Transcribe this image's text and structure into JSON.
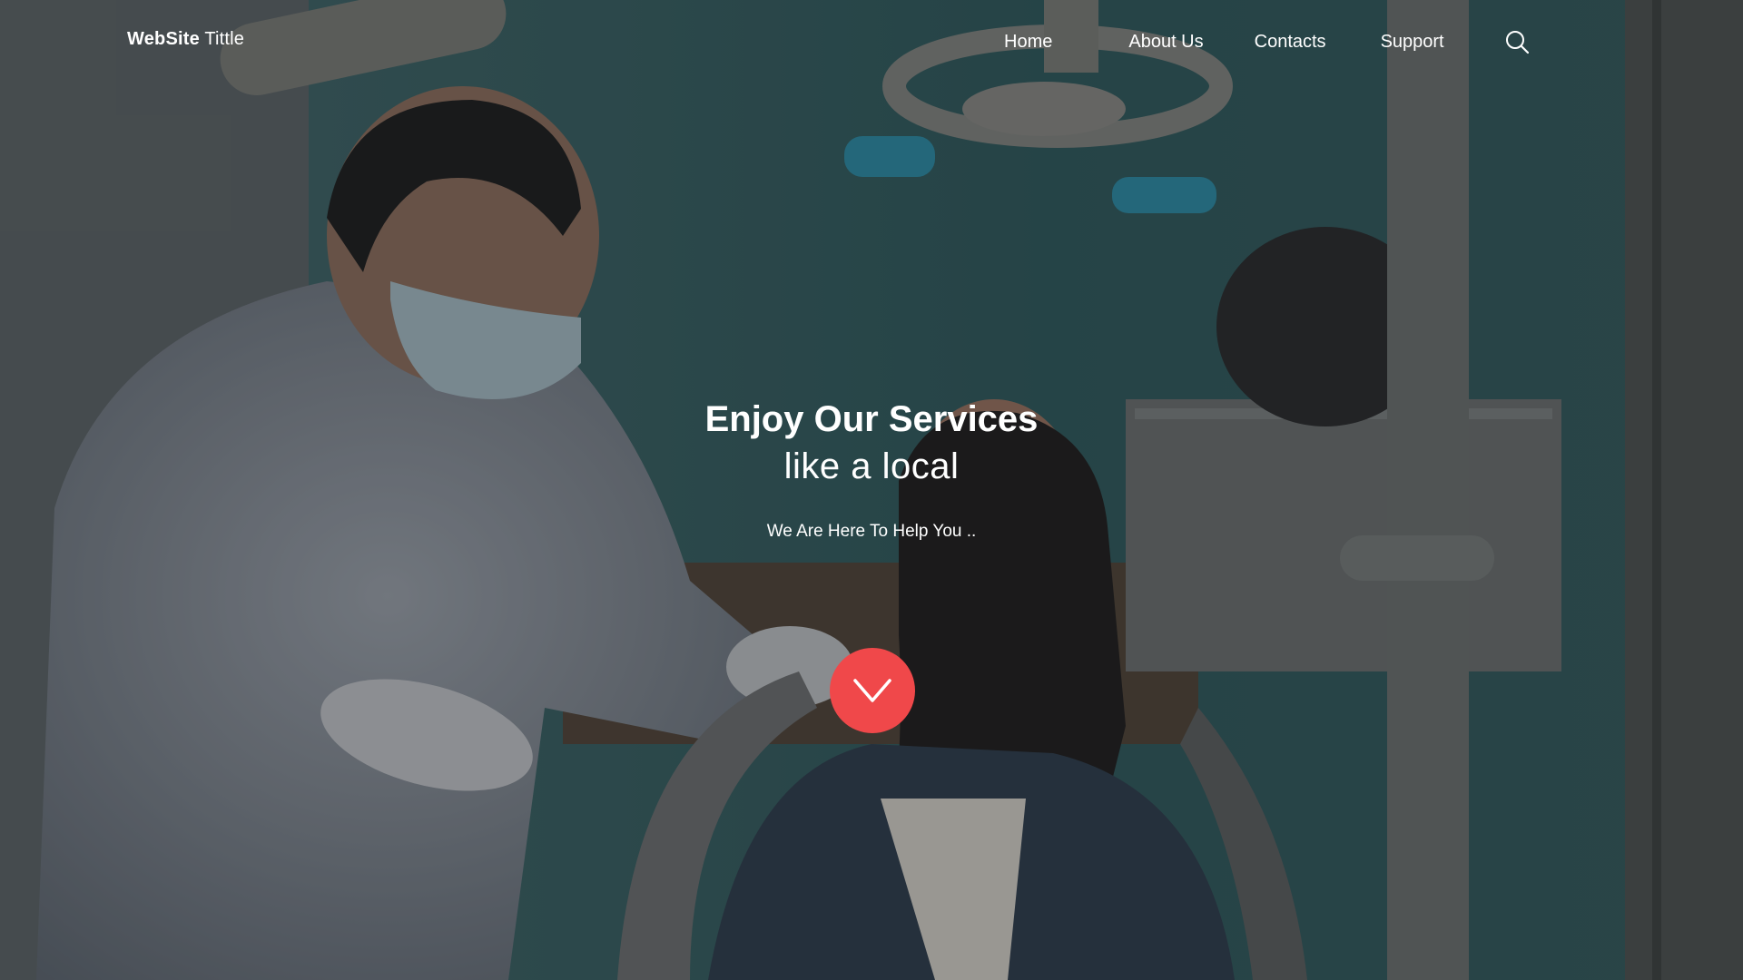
{
  "header": {
    "brand_strong": "WebSite",
    "brand_light": " Tittle",
    "nav": {
      "home": "Home",
      "about": "About Us",
      "contacts": "Contacts",
      "support": "Support"
    },
    "search_icon": "search-icon"
  },
  "hero": {
    "title": "Enjoy Our Services",
    "subtitle": "like a local",
    "tagline": "We Are Here To Help You ..",
    "scroll_icon": "chevron-down-icon",
    "background_image": "dentist-with-patient-photo"
  },
  "colors": {
    "accent": "#f0484a",
    "text": "#ffffff",
    "wall": "#3f6a6c"
  }
}
